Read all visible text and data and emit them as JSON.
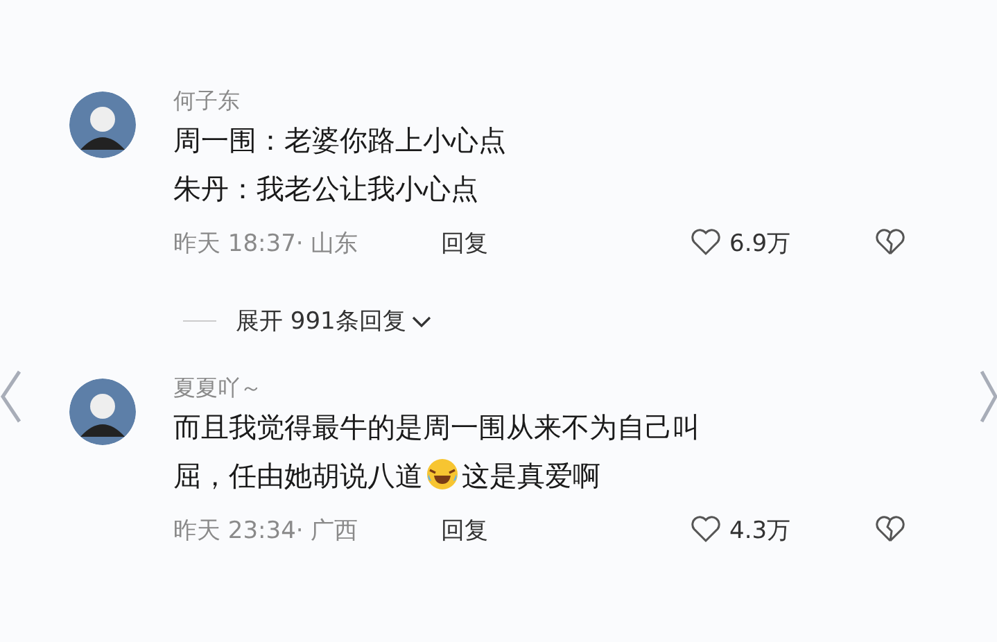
{
  "comments": [
    {
      "name": "何子东",
      "lines": [
        [
          {
            "kind": "text",
            "text": "周一围：老婆你路上小心点"
          }
        ],
        [
          {
            "kind": "text",
            "text": "朱丹：我老公让我小心点"
          }
        ]
      ],
      "meta": "昨天 18:37· 山东",
      "reply": "回复",
      "likes": "6.9万",
      "expand": "展开 991条回复"
    },
    {
      "name": "夏夏吖～",
      "lines": [
        [
          {
            "kind": "text",
            "text": "而且我觉得最牛的是周一围从来不为自己叫"
          }
        ],
        [
          {
            "kind": "text",
            "text": "屈，任由她胡说八道"
          },
          {
            "kind": "emoji"
          },
          {
            "kind": "text",
            "text": "这是真爱啊"
          }
        ]
      ],
      "meta": "昨天 23:34· 广西",
      "reply": "回复",
      "likes": "4.3万"
    }
  ]
}
